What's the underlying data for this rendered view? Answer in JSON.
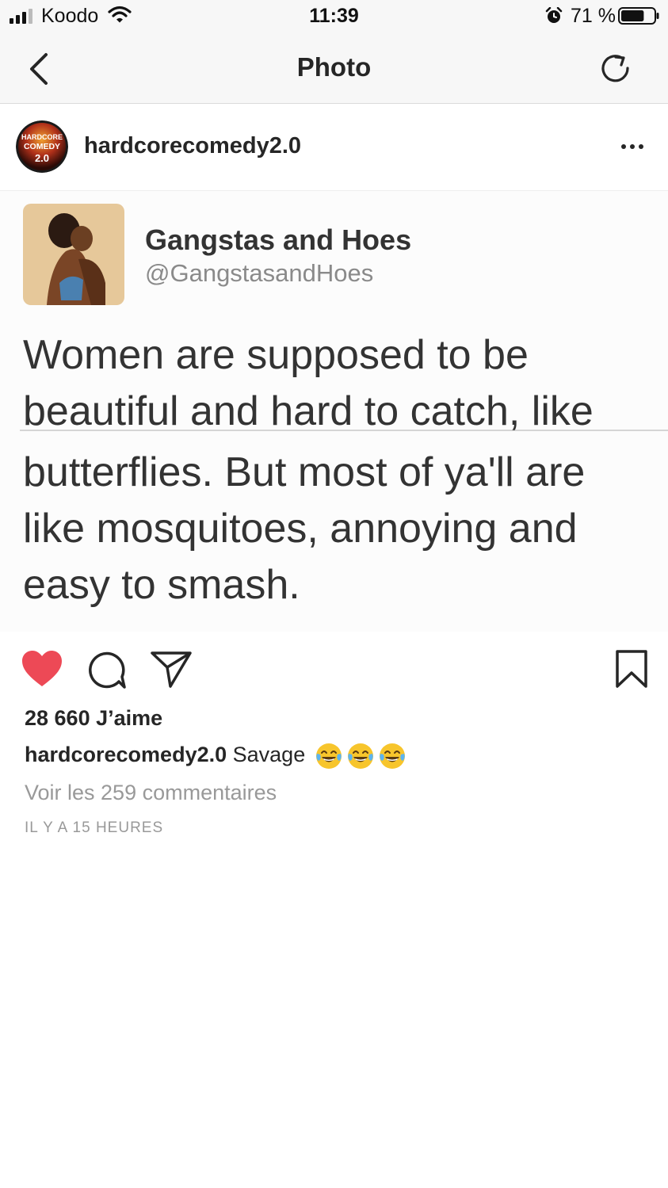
{
  "status_bar": {
    "carrier": "Koodo",
    "time": "11:39",
    "battery_percent": "71 %",
    "battery_level": 0.71,
    "signal_bars": 3,
    "icons": [
      "signal-icon",
      "wifi-icon",
      "alarm-icon",
      "battery-icon"
    ]
  },
  "nav": {
    "title": "Photo",
    "icons": [
      "back-chevron-icon",
      "refresh-icon"
    ]
  },
  "post": {
    "username": "hardcorecomedy2.0",
    "avatar_label": "HARDCORE COMEDY 2.0",
    "more_icon": "more-dots-icon",
    "tweet": {
      "name": "Gangstas and Hoes",
      "handle": "@GangstasandHoes",
      "text_lines": [
        "Women are supposed to be",
        "beautiful and hard to catch, like",
        "butterflies. But most of ya'll are",
        "like mosquitoes, annoying and",
        "easy to smash."
      ]
    },
    "actions": {
      "like_icon": "heart-filled-icon",
      "comment_icon": "comment-icon",
      "share_icon": "share-icon",
      "save_icon": "bookmark-icon",
      "liked": true,
      "like_color": "#ed4956"
    },
    "likes": "28 660 J’aime",
    "caption_user": "hardcorecomedy2.0",
    "caption_text": "Savage",
    "caption_emoji": "face-with-tears-of-joy",
    "caption_emoji_count": 3,
    "view_comments": "Voir les 259 commentaires",
    "timestamp": "IL Y A 15 HEURES"
  }
}
